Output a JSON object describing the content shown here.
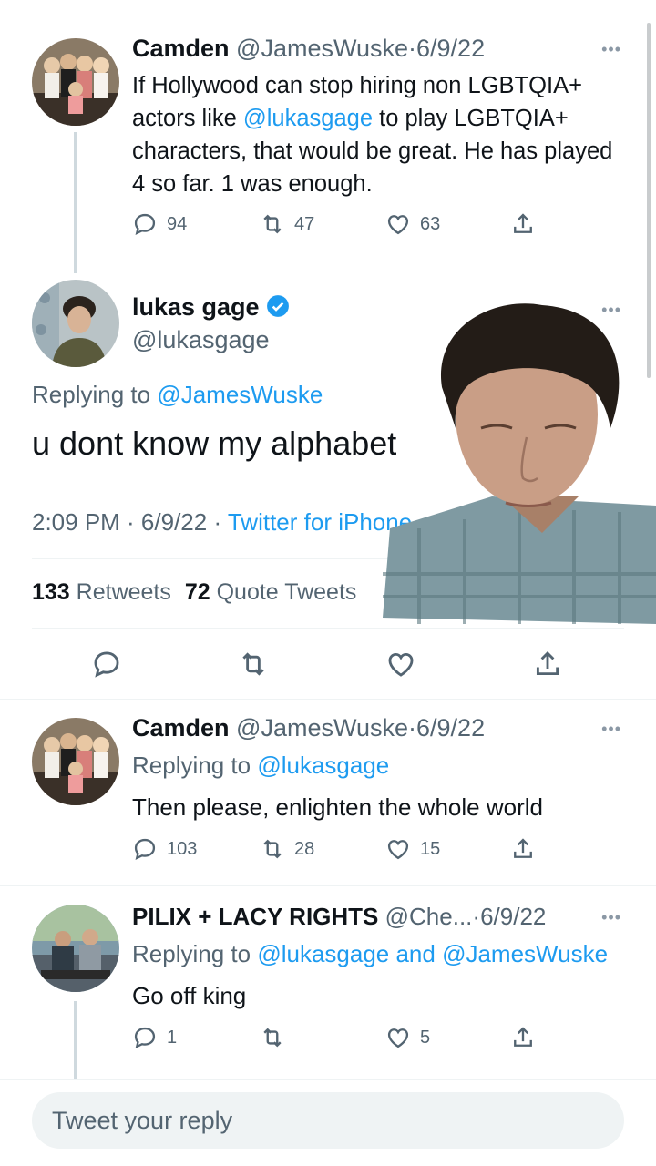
{
  "tweet1": {
    "name": "Camden",
    "handle": "@JamesWuske",
    "date_sep": "·",
    "date": "6/9/22",
    "text_pre": "If Hollywood can stop hiring non LGBTQIA+ actors like ",
    "mention": "@lukasgage",
    "text_post": " to play LGBTQIA+ characters, that would be great. He has played 4 so far. 1 was enough.",
    "replies": "94",
    "retweets": "47",
    "likes": "63"
  },
  "main": {
    "name": "lukas gage",
    "handle": "@lukasgage",
    "replying_label": "Replying to ",
    "replying_to": "@JamesWuske",
    "text": "u dont know my alphabet",
    "time": "2:09 PM · 6/9/22 · ",
    "source": "Twitter for iPhone",
    "retweets_count": "133",
    "retweets_label": " Retweets",
    "quotes_count": "72",
    "quotes_label": " Quote Tweets"
  },
  "reply1": {
    "name": "Camden",
    "handle": "@JamesWuske",
    "date_sep": "·",
    "date": "6/9/22",
    "replying_label": "Replying to ",
    "replying_to": "@lukasgage",
    "text": "Then please, enlighten the whole world",
    "replies": "103",
    "retweets": "28",
    "likes": "15"
  },
  "reply2": {
    "name": "PILIX + LACY RIGHTS",
    "handle": "@Che...",
    "date_sep": "·",
    "date": "6/9/22",
    "replying_label": "Replying to ",
    "replying_to_1": "@lukasgage",
    "and_label": " and ",
    "replying_to_2": "@JamesWuske",
    "text": "Go off king",
    "replies": "1",
    "retweets": "",
    "likes": "5"
  },
  "compose": {
    "placeholder": "Tweet your reply"
  },
  "icons": {
    "reply": "reply-icon",
    "retweet": "retweet-icon",
    "like": "heart-icon",
    "share": "share-icon",
    "verified": "verified-badge-icon",
    "more": "more-icon"
  },
  "colors": {
    "accent": "#1d9bf0",
    "secondary_text": "#536471",
    "verified": "#1d9bf0"
  }
}
